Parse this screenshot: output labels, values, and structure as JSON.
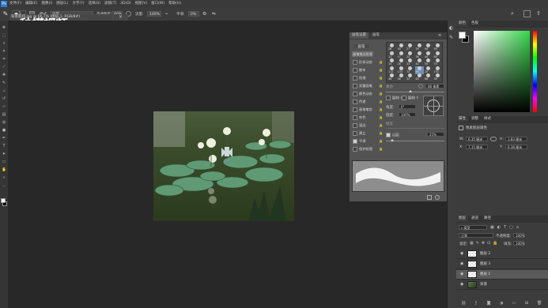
{
  "app": {
    "watermark": "秒懂视频",
    "watermark_latin": "dong"
  },
  "menubar": {
    "items": [
      "文件(F)",
      "编辑(E)",
      "图像(I)",
      "图层(L)",
      "文字(Y)",
      "选择(S)",
      "滤镜(T)",
      "3D(D)",
      "视图(V)",
      "窗口(W)",
      "帮助(H)"
    ]
  },
  "options": {
    "mode_label": "模式:",
    "mode_value": "正常",
    "opacity_label": "不透明度:",
    "opacity_value": "40%",
    "flow_label": "流量:",
    "flow_value": "100%",
    "smooth_label": "平滑:",
    "smooth_value": "0%",
    "brush_size": "5"
  },
  "document_tab": {
    "title": "背景影印.jpg @ 66.7% (图层 1, RGB/8#)"
  },
  "brush_panel": {
    "tabs": [
      "画笔设置",
      "画笔"
    ],
    "presets_button": "画笔",
    "options": [
      {
        "label": "画笔笔尖形状",
        "checked": false,
        "highlight": true
      },
      {
        "label": "形状动态",
        "checked": false
      },
      {
        "label": "散布",
        "checked": false
      },
      {
        "label": "纹理",
        "checked": false
      },
      {
        "label": "双重画笔",
        "checked": false
      },
      {
        "label": "颜色动态",
        "checked": false
      },
      {
        "label": "传递",
        "checked": false
      },
      {
        "label": "画笔笔势",
        "checked": false
      },
      {
        "label": "杂色",
        "checked": false
      },
      {
        "label": "湿边",
        "checked": false
      },
      {
        "label": "建立",
        "checked": false
      },
      {
        "label": "平滑",
        "checked": true
      },
      {
        "label": "保护纹理",
        "checked": false
      }
    ],
    "tip_sizes": [
      "28",
      "30",
      "27",
      "39",
      "46",
      "59",
      "11",
      "17",
      "23",
      "36",
      "44",
      "60",
      "14",
      "26",
      "33",
      "42",
      "55",
      "70",
      "112",
      "134",
      "74",
      "95",
      "29",
      "192",
      "36",
      "36",
      "33",
      "63",
      "66",
      "39"
    ],
    "size_label": "大小",
    "size_value": "88 像素",
    "flip_x": "翻转 X",
    "flip_y": "翻转 Y",
    "angle_label": "角度:",
    "angle_value": "0°",
    "roundness_label": "圆度:",
    "roundness_value": "100%",
    "hardness_label": "硬度",
    "spacing_label": "间距",
    "spacing_value": "25%"
  },
  "color_panel": {
    "tabs": [
      "颜色",
      "色板"
    ],
    "foreground": "#ffffff",
    "background": "#000000",
    "field_hue_color": "#37d64b"
  },
  "properties_panel": {
    "tabs": [
      "属性",
      "调整",
      "样式"
    ],
    "title": "像素图层属性",
    "w_label": "W:",
    "w_value": "6.35 厘米",
    "h_label": "H:",
    "h_value": "1.83 厘米",
    "x_label": "X:",
    "x_value": "7.15 厘米",
    "y_label": "Y:",
    "y_value": "6.38 厘米",
    "link_label": "GO"
  },
  "layers_panel": {
    "tabs": [
      "图层",
      "通道",
      "路径"
    ],
    "filter_label": "类型",
    "blend_mode": "正常",
    "opacity_label": "不透明度:",
    "opacity_value": "100%",
    "lock_label": "锁定:",
    "fill_label": "填充:",
    "fill_value": "100%",
    "layers": [
      {
        "name": "图层 2",
        "selected": false,
        "thumb": "checker"
      },
      {
        "name": "图层 3",
        "selected": false,
        "thumb": "checker"
      },
      {
        "name": "图层 1",
        "selected": true,
        "thumb": "checker"
      },
      {
        "name": "背景",
        "selected": false,
        "thumb": "photo"
      }
    ]
  }
}
